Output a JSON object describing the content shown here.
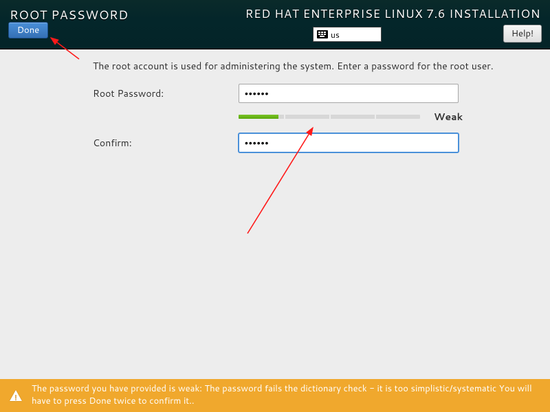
{
  "header": {
    "spoke_title": "ROOT PASSWORD",
    "install_title": "RED HAT ENTERPRISE LINUX 7.6 INSTALLATION",
    "done_label": "Done",
    "help_label": "Help!",
    "keyboard_layout": "us"
  },
  "body": {
    "intro": "The root account is used for administering the system.  Enter a password for the root user.",
    "root_password_label": "Root Password:",
    "confirm_label": "Confirm:",
    "root_password_value": "••••••",
    "confirm_value": "••••••",
    "strength_label": "Weak",
    "strength_fill_percent": 22
  },
  "warning": {
    "message": "The password you have provided is weak: The password fails the dictionary check - it is too simplistic/systematic You will have to press Done twice to confirm it.."
  },
  "colors": {
    "accent_blue": "#4a90d9",
    "warning_bg": "#f0a82d",
    "strength_green": "#6fbf17"
  }
}
